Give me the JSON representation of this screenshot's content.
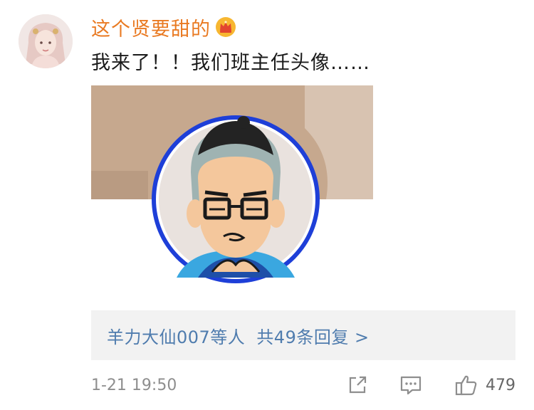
{
  "comment": {
    "username": "这个贤要甜的",
    "text": "我来了！！我们班主任头像……",
    "replies": {
      "names": "羊力大仙007等人",
      "count_text": "共49条回复 >"
    },
    "timestamp": "1-21 19:50",
    "likes": "479"
  },
  "icons": {
    "badge": "crown-icon",
    "share": "share-icon",
    "comment": "comment-icon",
    "like": "thumbs-up-icon"
  },
  "colors": {
    "username": "#e97a22",
    "link": "#4f7cae",
    "meta": "#8e8e8e",
    "reply_box": "#f2f2f2",
    "image_bg": "#c9ad93",
    "cartoon_ring": "#1e3fd8"
  }
}
